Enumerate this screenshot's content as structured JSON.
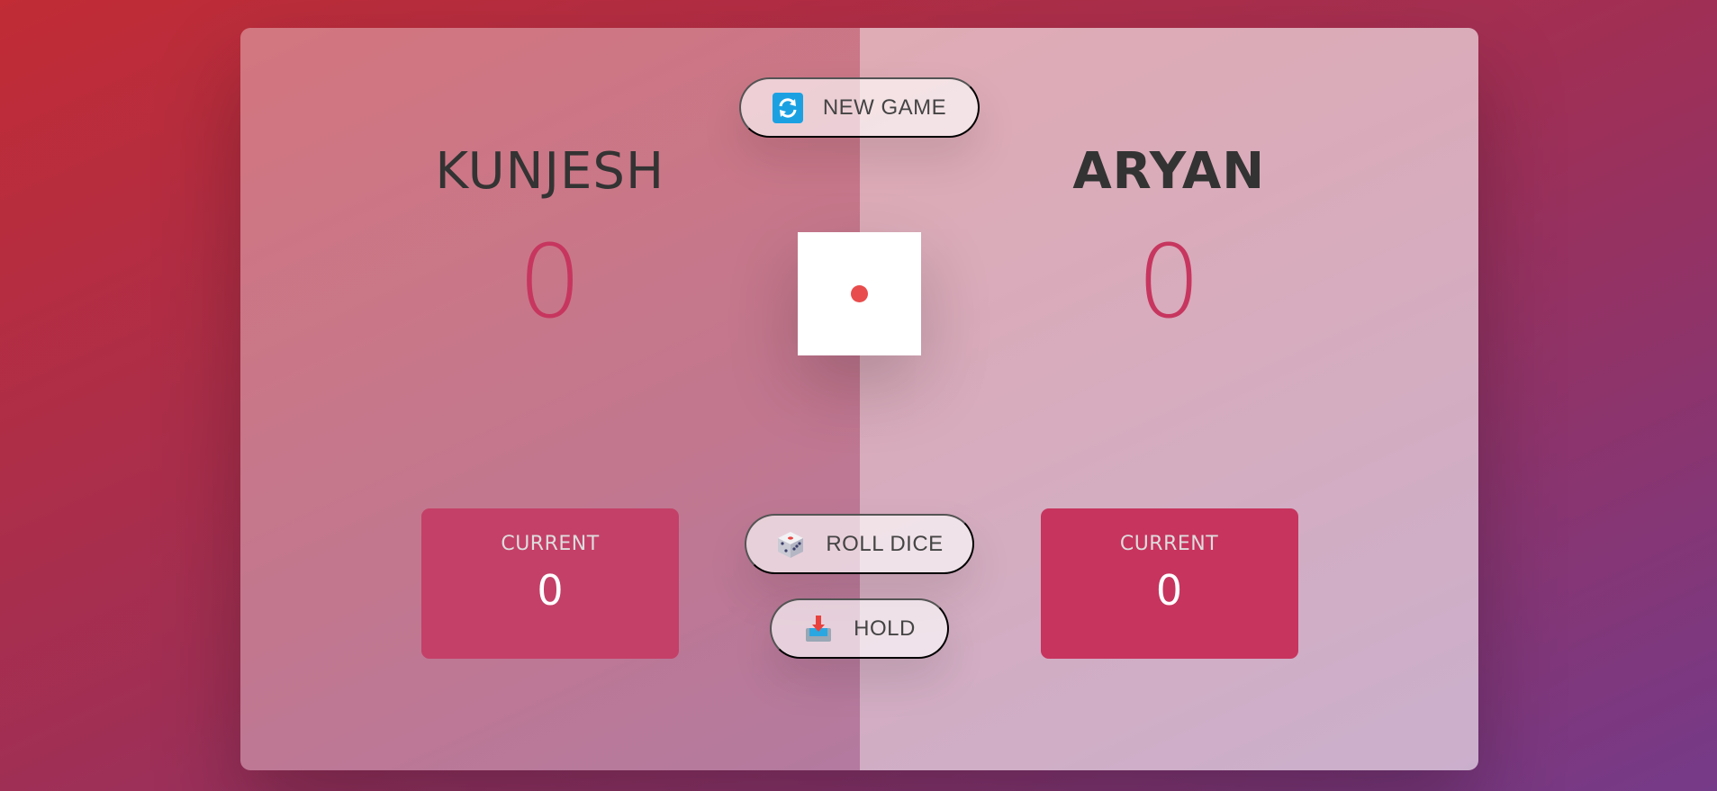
{
  "players": [
    {
      "name": "KUNJESH",
      "score": "0",
      "current_label": "CURRENT",
      "current_score": "0"
    },
    {
      "name": "ARYAN",
      "score": "0",
      "current_label": "CURRENT",
      "current_score": "0"
    }
  ],
  "buttons": {
    "new_game": {
      "label": "NEW GAME",
      "icon": "refresh-icon"
    },
    "roll_dice": {
      "label": "ROLL DICE",
      "icon": "dice-icon"
    },
    "hold": {
      "label": "HOLD",
      "icon": "inbox-tray-icon"
    }
  },
  "dice": {
    "value": 1
  },
  "colors": {
    "score": "#c7365f",
    "current_box_player0": "#c44068",
    "current_box_player1": "#c7345e",
    "dice_dot": "#e84c4c"
  }
}
